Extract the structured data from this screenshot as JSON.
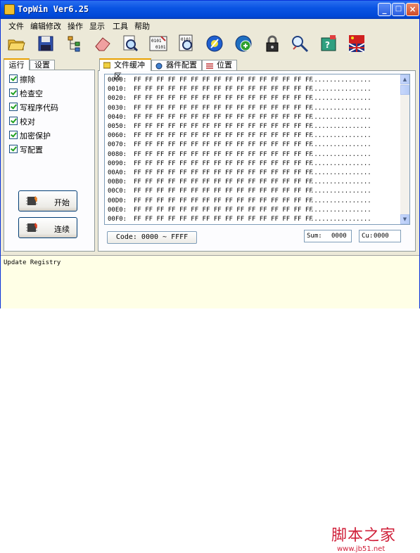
{
  "window": {
    "title": "TopWin Ver6.25",
    "minimize": "_",
    "maximize": "□",
    "close": "×"
  },
  "menu": [
    "文件",
    "编辑修改",
    "操作",
    "显示",
    "工具",
    "帮助"
  ],
  "toolbar_icons": [
    "open-folder-icon",
    "save-disk-icon",
    "tree-icon",
    "eraser-icon",
    "search-doc-icon",
    "binary-compare-icon",
    "binary-search-icon",
    "settings-gear-icon",
    "auto-run-icon",
    "lock-icon",
    "probe-icon",
    "hardware-info-icon",
    "language-flag-icon"
  ],
  "left_tabs": [
    "运行",
    "设置"
  ],
  "options": [
    "擦除",
    "检查空",
    "写程序代码",
    "校对",
    "加密保护",
    "写配置"
  ],
  "buttons": {
    "start": "开始",
    "continuous": "连续"
  },
  "right_tabs": [
    "文件缓冲区",
    "器件配置",
    "位置"
  ],
  "hex": {
    "addresses": [
      "0000:",
      "0010:",
      "0020:",
      "0030:",
      "0040:",
      "0050:",
      "0060:",
      "0070:",
      "0080:",
      "0090:",
      "00A0:",
      "00B0:",
      "00C0:",
      "00D0:",
      "00E0:",
      "00F0:"
    ],
    "bytes": "FF FF FF FF FF FF FF FF FF FF FF FF FF FF FF FF",
    "ascii": "................"
  },
  "code_range": "Code: 0000 ~ FFFF",
  "sum": {
    "label": "Sum:",
    "value": "0000"
  },
  "cu": {
    "label": "Cu:",
    "value": "0000"
  },
  "status": "Update Registry",
  "watermark": {
    "main": "脚本之家",
    "sub": "www.jb51.net"
  }
}
